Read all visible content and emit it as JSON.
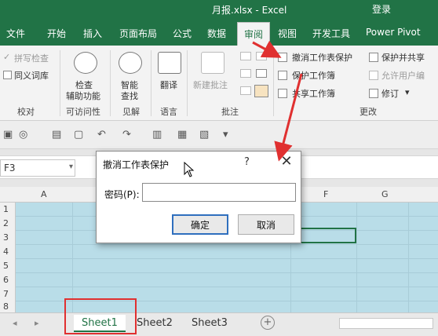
{
  "window": {
    "title": "月报.xlsx - Excel",
    "login": "登录"
  },
  "tabs": [
    {
      "label": "文件"
    },
    {
      "label": "开始"
    },
    {
      "label": "插入"
    },
    {
      "label": "页面布局"
    },
    {
      "label": "公式"
    },
    {
      "label": "数据"
    },
    {
      "label": "审阅"
    },
    {
      "label": "视图"
    },
    {
      "label": "开发工具"
    },
    {
      "label": "Power Pivot"
    }
  ],
  "ribbon": {
    "proofing": {
      "spellcheck": "拼写检查",
      "thesaurus": "同义词库",
      "group": "校对"
    },
    "accessibility": {
      "check_line1": "检查",
      "check_line2": "辅助功能",
      "group": "可访问性"
    },
    "insights": {
      "smart_line1": "智能",
      "smart_line2": "查找",
      "group": "见解"
    },
    "language": {
      "translate": "翻译",
      "group": "语言"
    },
    "comments": {
      "new_comment": "新建批注",
      "group": "批注"
    },
    "changes": {
      "unprotect_sheet": "撤消工作表保护",
      "protect_workbook": "保护工作簿",
      "share_workbook": "共享工作簿",
      "protect_share": "保护并共享",
      "allow_edit": "允许用户编",
      "track_changes": "修订",
      "group": "更改"
    }
  },
  "namebox": "F3",
  "columns": [
    "A",
    "F",
    "G"
  ],
  "rows": [
    "1",
    "2",
    "3",
    "4",
    "5",
    "6",
    "7",
    "8"
  ],
  "sheets": [
    {
      "name": "Sheet1"
    },
    {
      "name": "Sheet2"
    },
    {
      "name": "Sheet3"
    }
  ],
  "dialog": {
    "title": "撤消工作表保护",
    "help": "?",
    "password_label": "密码(P):",
    "password_value": "",
    "ok": "确定",
    "cancel": "取消"
  },
  "colors": {
    "excel_green": "#217346",
    "annotation_red": "#e03030",
    "sheet_fill": "#b9dde8"
  }
}
